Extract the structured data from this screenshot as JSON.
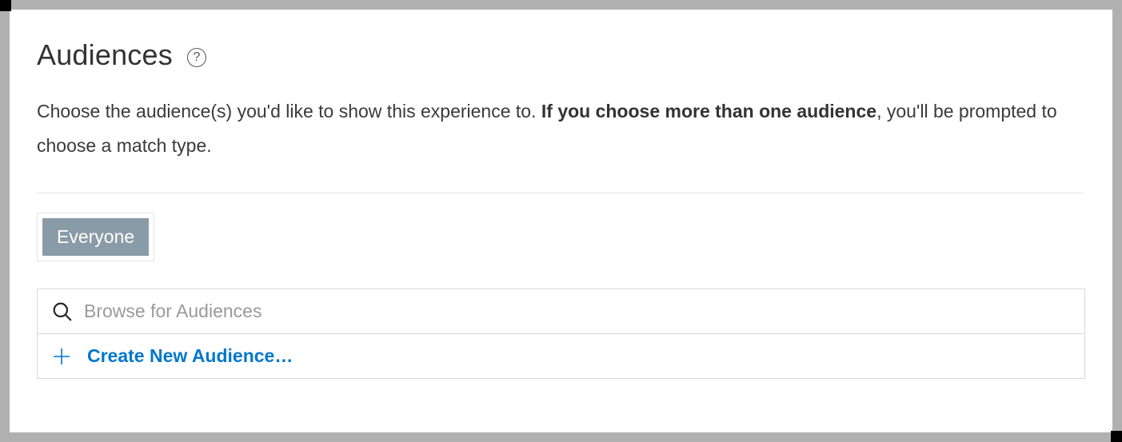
{
  "header": {
    "title": "Audiences"
  },
  "description": {
    "prefix": "Choose the audience(s) you'd like to show this experience to. ",
    "bold": "If you choose more than one audience",
    "suffix": ", you'll be prompted to choose a match type."
  },
  "selected_audiences": [
    {
      "label": "Everyone"
    }
  ],
  "search": {
    "placeholder": "Browse for Audiences"
  },
  "create": {
    "label": "Create New Audience…"
  }
}
